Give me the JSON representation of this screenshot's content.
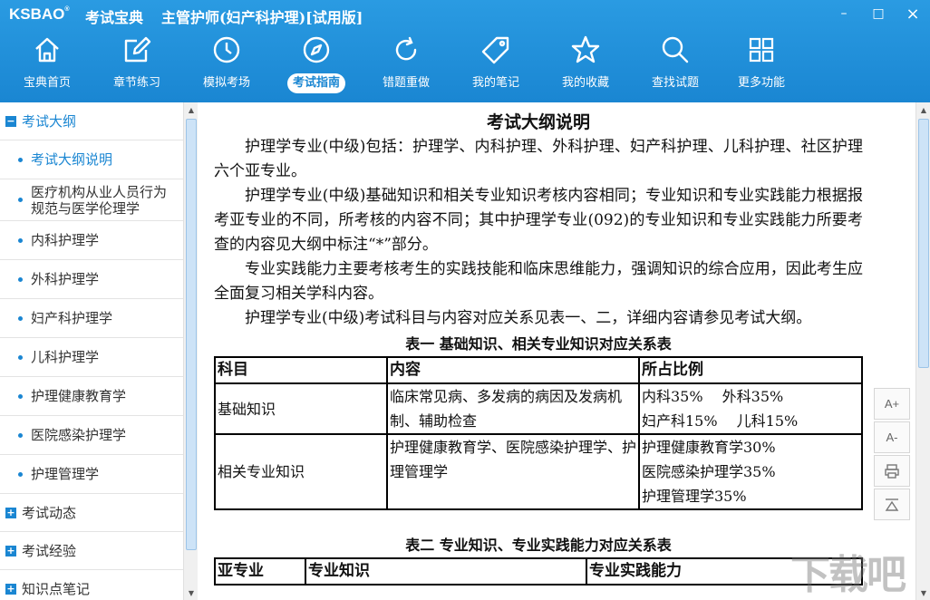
{
  "app": {
    "logo": "KSBAO",
    "logo_mark": "®",
    "brand": "考试宝典",
    "title": "主管护师(妇产科护理)[试用版]",
    "window_buttons": [
      "–",
      "□",
      "×"
    ]
  },
  "nav": [
    {
      "label": "宝典首页",
      "icon": "home-icon"
    },
    {
      "label": "章节练习",
      "icon": "edit-icon"
    },
    {
      "label": "模拟考场",
      "icon": "clock-icon"
    },
    {
      "label": "考试指南",
      "icon": "compass-icon",
      "active": true
    },
    {
      "label": "错题重做",
      "icon": "refresh-icon"
    },
    {
      "label": "我的笔记",
      "icon": "tag-icon"
    },
    {
      "label": "我的收藏",
      "icon": "star-icon"
    },
    {
      "label": "查找试题",
      "icon": "search-icon"
    },
    {
      "label": "更多功能",
      "icon": "grid-icon"
    }
  ],
  "sidebar": {
    "group_open": "考试大纲",
    "items": [
      "考试大纲说明",
      "医疗机构从业人员行为规范与医学伦理学",
      "内科护理学",
      "外科护理学",
      "妇产科护理学",
      "儿科护理学",
      "护理健康教育学",
      "医院感染护理学",
      "护理管理学"
    ],
    "groups_closed": [
      "考试动态",
      "考试经验",
      "知识点笔记"
    ]
  },
  "doc": {
    "title": "考试大纲说明",
    "paragraphs": [
      "护理学专业(中级)包括：护理学、内科护理、外科护理、妇产科护理、儿科护理、社区护理六个亚专业。",
      "护理学专业(中级)基础知识和相关专业知识考核内容相同；专业知识和专业实践能力根据报考亚专业的不同，所考核的内容不同；其中护理学专业(092)的专业知识和专业实践能力所要考查的内容见大纲中标注“*”部分。",
      "专业实践能力主要考核考生的实践技能和临床思维能力，强调知识的综合应用，因此考生应全面复习相关学科内容。",
      "护理学专业(中级)考试科目与内容对应关系见表一、二，详细内容请参见考试大纲。"
    ],
    "table1": {
      "caption": "表一 基础知识、相关专业知识对应关系表",
      "headers": [
        "科目",
        "内容",
        "所占比例"
      ],
      "rows": [
        {
          "subject": "基础知识",
          "content": "临床常见病、多发病的病因及发病机制、辅助检查",
          "ratio": [
            "内科35%　 外科35%",
            "妇产科15%　 儿科15%"
          ]
        },
        {
          "subject": "相关专业知识",
          "content": "护理健康教育学、医院感染护理学、护理管理学",
          "ratio": [
            "护理健康教育学30%",
            "医院感染护理学35%",
            "护理管理学35%"
          ]
        }
      ]
    },
    "table2": {
      "caption": "表二 专业知识、专业实践能力对应关系表",
      "headers": [
        "亚专业",
        "专业知识",
        "专业实践能力"
      ]
    }
  },
  "tools": [
    "A+",
    "A-",
    "print-icon",
    "scroll-top-icon"
  ],
  "watermark": "下载吧"
}
